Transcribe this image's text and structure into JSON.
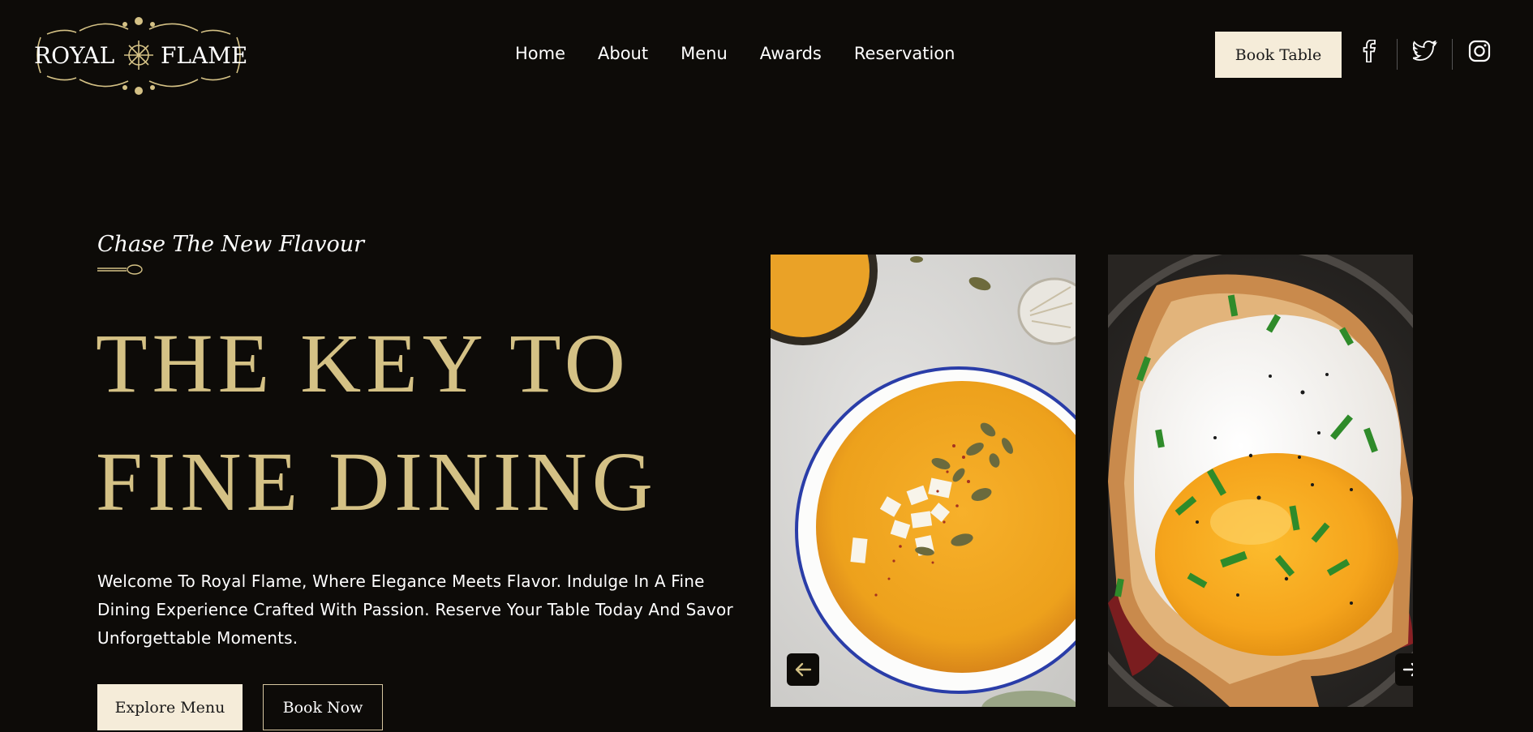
{
  "brand": {
    "name_left": "ROYAL",
    "name_right": "FLAME"
  },
  "nav": {
    "items": [
      {
        "label": "Home"
      },
      {
        "label": "About"
      },
      {
        "label": "Menu"
      },
      {
        "label": "Awards"
      },
      {
        "label": "Reservation"
      }
    ]
  },
  "header": {
    "book_table_label": "Book Table",
    "social_icons": [
      "facebook-icon",
      "twitter-icon",
      "instagram-icon"
    ]
  },
  "hero": {
    "tagline": "Chase The New Flavour",
    "headline_line1": "THE KEY TO",
    "headline_line2": "FINE DINING",
    "description": "Welcome To Royal Flame, Where Elegance Meets Flavor. Indulge In A Fine Dining Experience Crafted With Passion. Reserve Your Table Today And Savor Unforgettable Moments.",
    "explore_label": "Explore Menu",
    "book_now_label": "Book Now"
  },
  "gallery": {
    "images": [
      {
        "subject": "pumpkin soup bowl"
      },
      {
        "subject": "fried egg on toast"
      }
    ],
    "prev_icon": "arrow-left-icon",
    "next_icon": "arrow-right-icon"
  },
  "colors": {
    "background": "#0d0b08",
    "gold": "#d4c185",
    "cream": "#f5ecd9"
  }
}
